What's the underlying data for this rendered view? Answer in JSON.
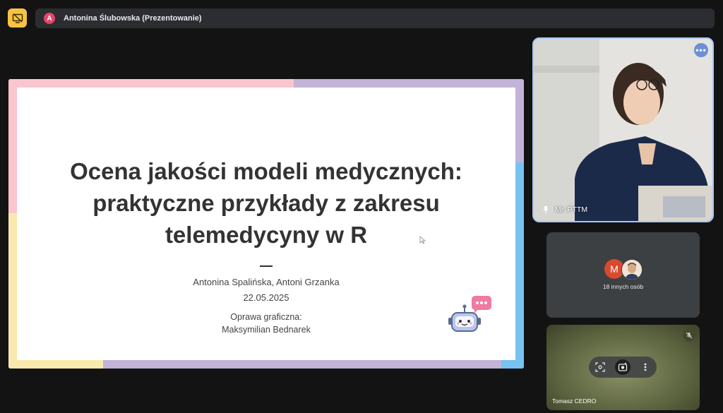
{
  "topbar": {
    "stop_presenting_icon": "screen-share-off-icon",
    "presenter_initial": "A",
    "presenter_label": "Antonina Ślubowska (Prezentowanie)"
  },
  "slide": {
    "title_lines": [
      "Ocena jakości modeli medycznych:",
      "praktyczne przykłady z zakresu",
      "telemedycyny w R"
    ],
    "dash": "—",
    "authors": "Antonina Spalińska, Antoni Grzanka",
    "date": "22.05.2025",
    "credit_label": "Oprawa graficzna:",
    "credit_name": "Maksymilian Bednarek",
    "colors": {
      "pink": "#f9c6cf",
      "lavender": "#c2b3d8",
      "yellow": "#fae9ae",
      "blue": "#77c3f2"
    }
  },
  "tiles": {
    "main": {
      "name": "Mr. PTTM",
      "more_icon": "more-options-icon",
      "pin_icon": "pin-icon"
    },
    "others": {
      "avatar_initial": "M",
      "label": "18 innych osób"
    },
    "bottom": {
      "name": "Tomasz CEDRO",
      "mute_icon": "mic-off-icon",
      "controls": [
        "frame-icon",
        "effects-icon",
        "more-vert-icon"
      ]
    }
  },
  "accent": "#a8c7fa"
}
